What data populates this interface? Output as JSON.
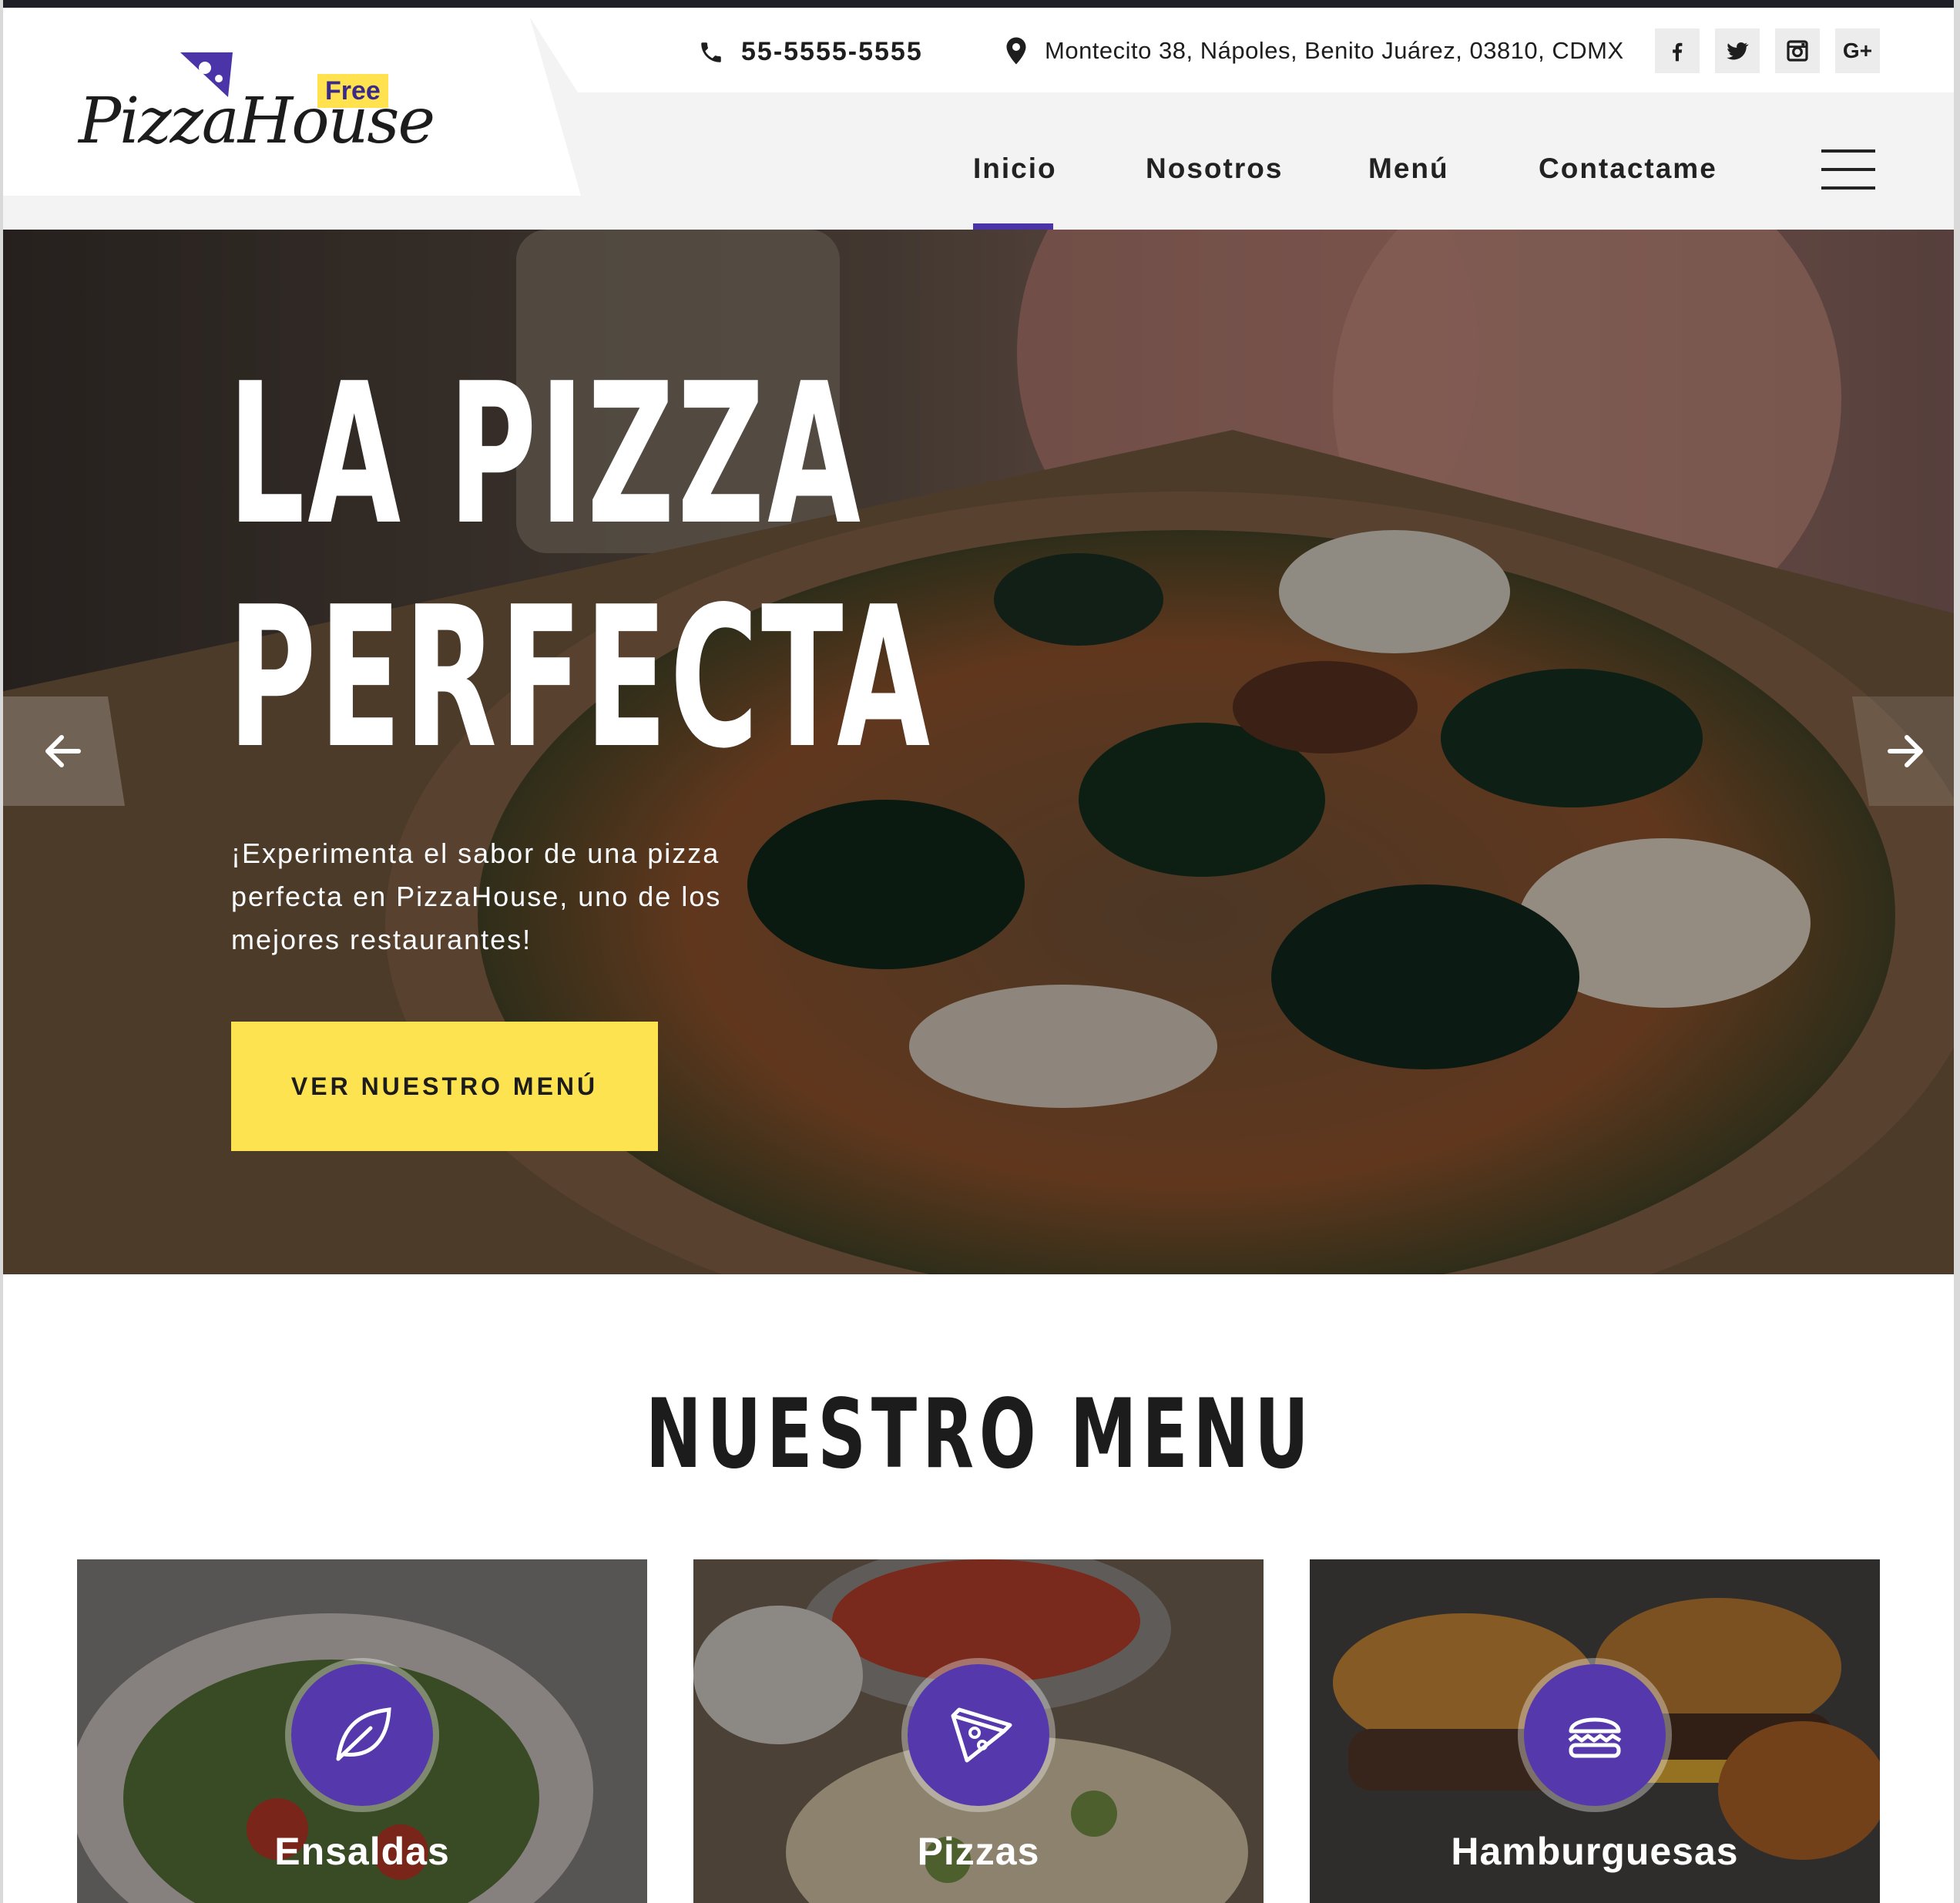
{
  "brand": {
    "logo_text": "PizzaHouse",
    "badge": "Free"
  },
  "contact": {
    "phone": "55-5555-5555",
    "address": "Montecito 38, Nápoles, Benito Juárez, 03810, CDMX"
  },
  "social": [
    {
      "icon": "facebook-icon",
      "glyph": "f"
    },
    {
      "icon": "twitter-icon",
      "glyph": "t"
    },
    {
      "icon": "instagram-icon",
      "glyph": "ig"
    },
    {
      "icon": "google-plus-icon",
      "glyph": "G+"
    }
  ],
  "nav": {
    "items": [
      "Inicio",
      "Nosotros",
      "Menú",
      "Contactame"
    ],
    "active": "Inicio"
  },
  "hero": {
    "title_line1": "LA PIZZA",
    "title_line2": "PERFECTA",
    "subtitle": "¡Experimenta el sabor de una pizza perfecta en PizzaHouse, uno de los mejores restaurantes!",
    "cta": "VER NUESTRO MENÚ"
  },
  "menu_section": {
    "heading": "NUESTRO MENU",
    "cards": [
      {
        "title": "Ensaldas",
        "icon": "leaf-icon"
      },
      {
        "title": "Pizzas",
        "icon": "pizza-slice-icon"
      },
      {
        "title": "Hamburguesas",
        "icon": "burger-icon"
      }
    ]
  },
  "colors": {
    "accent": "#5438ac",
    "cta": "#fde34f",
    "text_dark": "#1c1c1c"
  }
}
